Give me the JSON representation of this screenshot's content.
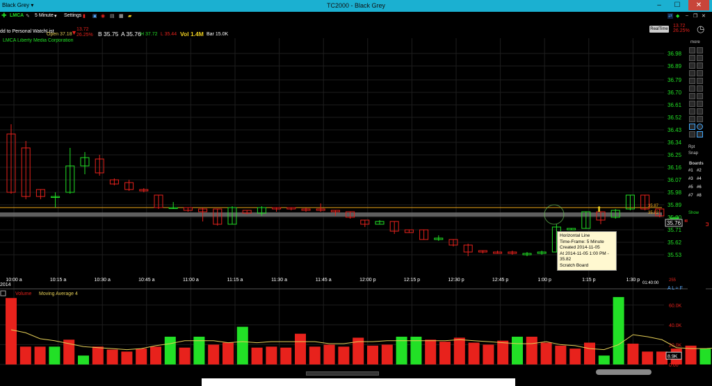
{
  "window": {
    "workspace": "Black Grey ▾",
    "title": "TC2000 - Black Grey",
    "min": "–",
    "max": "☐",
    "close": "✕"
  },
  "toolbar": {
    "symbol": "LMCA",
    "timeframe": "5 Minute",
    "settings": "Settings"
  },
  "quote": {
    "watchlist": "dd to Personal WatchList",
    "open": "Open 37.18",
    "change": "13.72",
    "change_pct": "26.25%",
    "bid": "B 35.75",
    "ask": "A 35.76",
    "high": "H 37.72",
    "low": "L 35.44",
    "vol": "Vol 1.4M",
    "bar": "Bar 15.0K",
    "realtime": "RealTime",
    "right_change": "13.72",
    "right_pct": "26.25%"
  },
  "company": "LMCA Liberty Media Corporation",
  "sidebar": {
    "more": "more",
    "rpt": "Rpt",
    "snap": "Snap",
    "show": "Show",
    "boards_title": "Boards",
    "boards": [
      "#1",
      "#2",
      "#3",
      "#4",
      "#5",
      "#6",
      "#7",
      "#8"
    ]
  },
  "tooltip": {
    "line1": "Horizontal Line",
    "line2": "Time-Frame: 5 Minute",
    "line3": "Created 2014-11-05",
    "line4": "At 2014-11-05 1:00 PM - 35.82",
    "line5": "Scratch Board"
  },
  "volume_panel": {
    "label": "Volume",
    "ma_label": "Moving Average 4",
    "current": "8.9K"
  },
  "misc": {
    "clock": "01:40:00",
    "year": "2014",
    "alf": "A L ≈ F",
    "tag_355": "255"
  },
  "colors": {
    "up": "#22e026",
    "down": "#e8221c",
    "grid": "#1e1e1e",
    "axis_text": "#22e026",
    "hline": "#f0a818",
    "ma": "#e6cf57"
  },
  "chart_data": [
    {
      "type": "candlestick",
      "title": "LMCA Liberty Media Corporation",
      "x_ticks": [
        "10:00 a",
        "10:15 a",
        "10:30 a",
        "10:45 a",
        "11:00 a",
        "11:15 a",
        "11:30 a",
        "11:45 a",
        "12:00 p",
        "12:15 p",
        "12:30 p",
        "12:45 p",
        "1:00 p",
        "1:15 p",
        "1:30 p"
      ],
      "ylim": [
        35.46,
        37.05
      ],
      "y_ticks": [
        "36.98",
        "36.89",
        "36.79",
        "36.70",
        "36.61",
        "36.52",
        "36.43",
        "36.34",
        "36.25",
        "36.16",
        "36.07",
        "35.98",
        "35.89",
        "35.80",
        "35.71",
        "35.62",
        "35.53"
      ],
      "price_labels": {
        "hline_top": "35.87",
        "hline_gray": "35.82",
        "last": "35.76"
      },
      "hlines": [
        35.87,
        35.82
      ],
      "candles": [
        [
          36.4,
          35.98,
          36.47,
          35.97
        ],
        [
          36.3,
          35.95,
          36.35,
          35.93
        ],
        [
          36.0,
          35.95,
          36.0,
          35.93
        ],
        [
          35.95,
          35.95,
          35.98,
          35.87
        ],
        [
          35.98,
          36.17,
          36.3,
          35.97
        ],
        [
          36.17,
          36.23,
          36.27,
          36.11
        ],
        [
          36.22,
          36.12,
          36.25,
          36.1
        ],
        [
          36.07,
          36.04,
          36.08,
          36.03
        ],
        [
          36.05,
          36.0,
          36.07,
          35.99
        ],
        [
          36.0,
          35.99,
          36.01,
          35.98
        ],
        [
          35.96,
          35.87,
          35.96,
          35.86
        ],
        [
          35.87,
          35.87,
          35.91,
          35.86
        ],
        [
          35.87,
          35.85,
          35.87,
          35.84
        ],
        [
          35.86,
          35.84,
          35.87,
          35.77
        ],
        [
          35.86,
          35.75,
          35.86,
          35.74
        ],
        [
          35.75,
          35.87,
          35.88,
          35.75
        ],
        [
          35.85,
          35.83,
          35.85,
          35.82
        ],
        [
          35.83,
          35.87,
          35.88,
          35.81
        ],
        [
          35.87,
          35.86,
          35.87,
          35.84
        ],
        [
          35.87,
          35.86,
          35.87,
          35.85
        ],
        [
          35.86,
          35.85,
          35.87,
          35.84
        ],
        [
          35.86,
          35.85,
          35.9,
          35.84
        ],
        [
          35.85,
          35.84,
          35.85,
          35.81
        ],
        [
          35.84,
          35.8,
          35.84,
          35.79
        ],
        [
          35.78,
          35.75,
          35.78,
          35.73
        ],
        [
          35.75,
          35.77,
          35.78,
          35.75
        ],
        [
          35.77,
          35.7,
          35.77,
          35.68
        ],
        [
          35.71,
          35.69,
          35.71,
          35.69
        ],
        [
          35.71,
          35.64,
          35.71,
          35.64
        ],
        [
          35.64,
          35.65,
          35.67,
          35.63
        ],
        [
          35.64,
          35.6,
          35.64,
          35.59
        ],
        [
          35.6,
          35.55,
          35.61,
          35.52
        ],
        [
          35.56,
          35.55,
          35.56,
          35.54
        ],
        [
          35.55,
          35.54,
          35.56,
          35.54
        ],
        [
          35.55,
          35.54,
          35.56,
          35.53
        ],
        [
          35.53,
          35.54,
          35.55,
          35.52
        ],
        [
          35.54,
          35.55,
          35.56,
          35.53
        ],
        [
          35.55,
          35.73,
          35.75,
          35.55
        ],
        [
          35.71,
          35.72,
          35.72,
          35.71
        ],
        [
          35.72,
          35.84,
          35.84,
          35.72
        ],
        [
          35.84,
          35.78,
          35.84,
          35.75
        ],
        [
          35.8,
          35.85,
          35.86,
          35.79
        ],
        [
          35.86,
          35.96,
          35.96,
          35.85
        ],
        [
          35.96,
          35.86,
          35.96,
          35.85
        ],
        [
          35.86,
          35.81,
          35.86,
          35.8
        ],
        [
          35.8,
          35.8,
          35.8,
          35.78
        ],
        [
          35.78,
          35.77,
          35.78,
          35.76
        ],
        [
          35.76,
          35.74,
          35.76,
          35.73
        ],
        [
          35.75,
          35.76,
          35.76,
          35.75
        ],
        [
          35.74,
          35.66,
          35.74,
          35.65
        ]
      ],
      "volume_ticks": [
        "60.0K",
        "40.0K",
        "20.0K",
        "0.00"
      ],
      "volume_ylim": [
        0,
        70000
      ],
      "volume": [
        67000,
        18000,
        18000,
        18000,
        25000,
        9000,
        18000,
        15000,
        13000,
        16000,
        18000,
        28000,
        17000,
        28000,
        20000,
        22000,
        38000,
        17000,
        18000,
        17000,
        31000,
        18000,
        20000,
        18000,
        27000,
        19000,
        20000,
        28000,
        28000,
        25000,
        23000,
        27000,
        22000,
        20000,
        24000,
        28000,
        28000,
        22000,
        19000,
        16000,
        22000,
        9000,
        68000,
        21000,
        13000,
        13000,
        16000,
        19000,
        16000,
        17000,
        17000,
        16000,
        17000,
        16000
      ],
      "moving_average_4": [
        35000,
        32000,
        26000,
        24000,
        21000,
        18000,
        17000,
        16000,
        15000,
        16000,
        19000,
        21000,
        24000,
        24000,
        24000,
        22000,
        23000,
        22000,
        23000,
        23000,
        23000,
        23000,
        21000,
        21000,
        23000,
        23000,
        24000,
        24000,
        24000,
        24000,
        24000,
        25000,
        24000,
        23000,
        22000,
        21000,
        21000,
        23000,
        20000,
        19000,
        16000,
        15000,
        20000,
        30000,
        28000,
        25000,
        17000,
        16000,
        16000,
        17000,
        17000,
        17000,
        16000,
        16000
      ]
    }
  ]
}
